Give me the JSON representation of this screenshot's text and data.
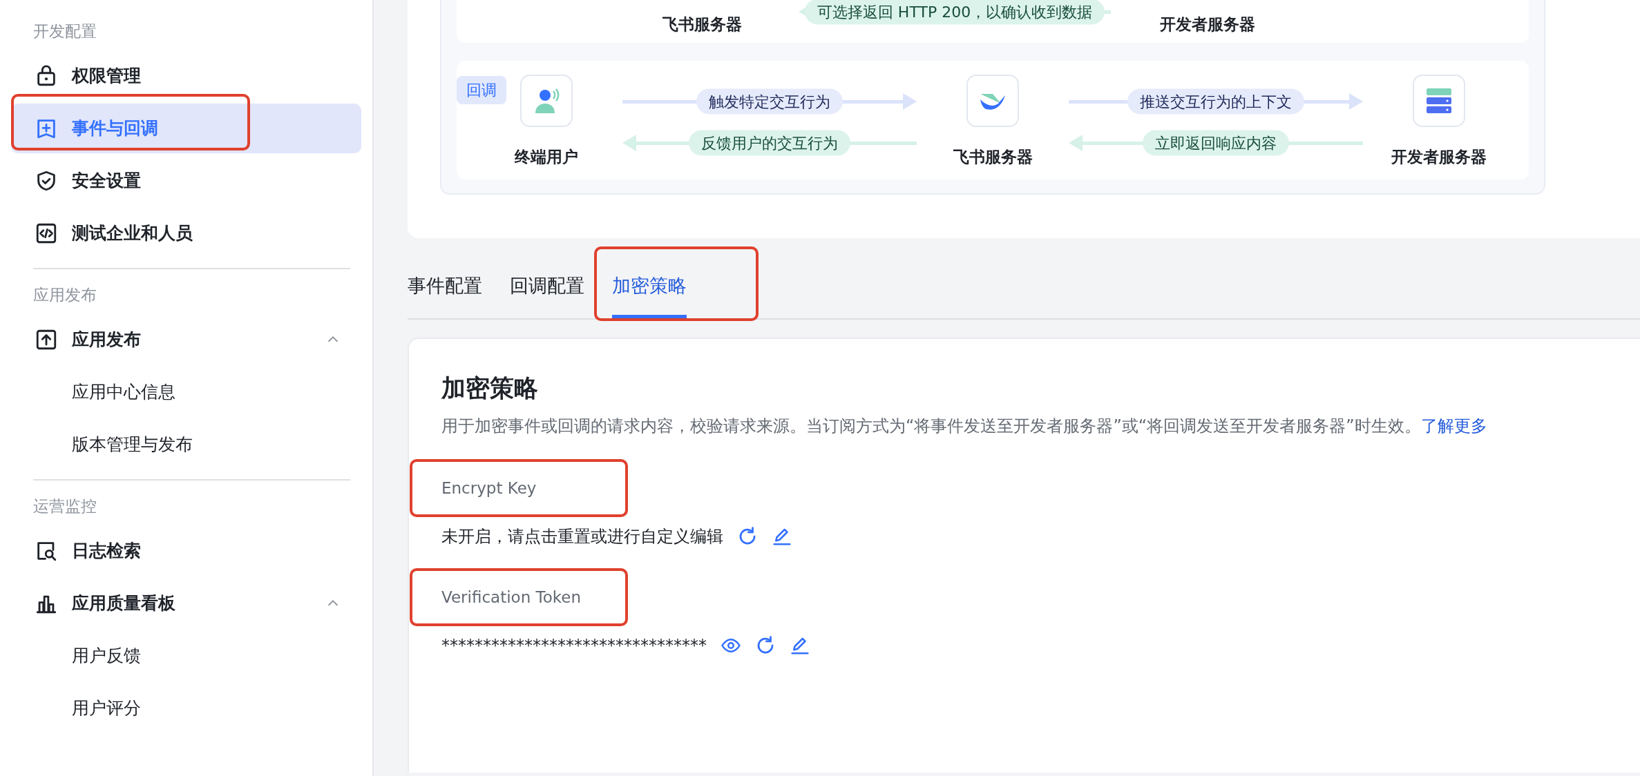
{
  "sidebar": {
    "sections": [
      {
        "title": "开发配置",
        "items": [
          {
            "label": "权限管理",
            "selected": false,
            "annotated": false
          },
          {
            "label": "事件与回调",
            "selected": true,
            "annotated": true
          },
          {
            "label": "安全设置",
            "selected": false,
            "annotated": false
          },
          {
            "label": "测试企业和人员",
            "selected": false,
            "annotated": false
          }
        ]
      },
      {
        "title": "应用发布",
        "items": [
          {
            "label": "应用发布",
            "selected": false,
            "annotated": false,
            "expanded": true,
            "children": [
              {
                "label": "应用中心信息",
                "selected": false
              },
              {
                "label": "版本管理与发布",
                "selected": false
              }
            ]
          }
        ]
      },
      {
        "title": "运营监控",
        "items": [
          {
            "label": "日志检索",
            "selected": false,
            "annotated": false
          },
          {
            "label": "应用质量看板",
            "selected": false,
            "annotated": false,
            "expanded": true,
            "children": [
              {
                "label": "用户反馈",
                "selected": false
              },
              {
                "label": "用户评分",
                "selected": false
              }
            ]
          }
        ]
      }
    ]
  },
  "diagram": {
    "partial_row": {
      "nodes": [
        "飞书服务器",
        "开发者服务器"
      ],
      "back_label": "可选择返回 HTTP 200，以确认收到数据"
    },
    "callback_row": {
      "tag": "回调",
      "nodes": [
        {
          "label": "终端用户",
          "kind": "user"
        },
        {
          "label": "飞书服务器",
          "kind": "platform"
        },
        {
          "label": "开发者服务器",
          "kind": "server"
        }
      ],
      "links": [
        {
          "forward": "触发特定交互行为",
          "back": "反馈用户的交互行为"
        },
        {
          "forward": "推送交互行为的上下文",
          "back": "立即返回响应内容"
        }
      ]
    }
  },
  "tabs": [
    {
      "label": "事件配置",
      "selected": false,
      "annotated": false
    },
    {
      "label": "回调配置",
      "selected": false,
      "annotated": false
    },
    {
      "label": "加密策略",
      "selected": true,
      "annotated": true
    }
  ],
  "panel": {
    "title": "加密策略",
    "description": "用于加密事件或回调的请求内容，校验请求来源。当订阅方式为“将事件发送至开发者服务器”或“将回调发送至开发者服务器”时生效。",
    "link": "了解更多",
    "fields": [
      {
        "label": "Encrypt Key",
        "value": "未开启，请点击重置或进行自定义编辑",
        "annotated": true,
        "actions": [
          {
            "kind": "reset"
          },
          {
            "kind": "edit"
          }
        ]
      },
      {
        "label": "Verification Token",
        "value": "********************************",
        "annotated": true,
        "actions": [
          {
            "kind": "reveal"
          },
          {
            "kind": "reset"
          },
          {
            "kind": "edit"
          }
        ]
      }
    ]
  }
}
